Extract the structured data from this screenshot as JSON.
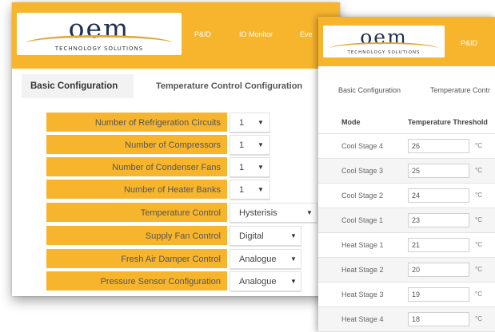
{
  "back_window": {
    "logo": {
      "word": "oem",
      "tagline": "TECHNOLOGY SOLUTIONS"
    },
    "nav": [
      "P&ID",
      "IO Monitor",
      "Eve"
    ],
    "tabs": [
      {
        "label": "Basic Configuration",
        "active": true
      },
      {
        "label": "Temperature Control Configuration",
        "active": false
      }
    ],
    "form": [
      {
        "label": "Number of Refrigeration Circuits",
        "value": "1"
      },
      {
        "label": "Number of Compressors",
        "value": "1"
      },
      {
        "label": "Number of Condenser Fans",
        "value": "1"
      },
      {
        "label": "Number of Heater Banks",
        "value": "1"
      },
      {
        "label": "Temperature Control",
        "value": "Hysterisis"
      },
      {
        "label": "Supply Fan Control",
        "value": "Digital"
      },
      {
        "label": "Fresh Air Damper Control",
        "value": "Analogue"
      },
      {
        "label": "Pressure Sensor Configuration",
        "value": "Analogue"
      }
    ],
    "caret": "▼"
  },
  "front_window": {
    "logo": {
      "word": "oem",
      "tagline": "TECHNOLOGY SOLUTIONS"
    },
    "nav": [
      "P&ID"
    ],
    "tabs": [
      {
        "label": "Basic Configuration",
        "active": false
      },
      {
        "label": "Temperature Contr",
        "active": true
      }
    ],
    "table": {
      "headers": [
        "Mode",
        "Temperature Threshold"
      ],
      "unit": "°C",
      "rows": [
        {
          "mode": "Cool Stage 4",
          "threshold": "26"
        },
        {
          "mode": "Cool Stage 3",
          "threshold": "25"
        },
        {
          "mode": "Cool Stage 2",
          "threshold": "24"
        },
        {
          "mode": "Cool Stage 1",
          "threshold": "23"
        },
        {
          "mode": "Heat Stage 1",
          "threshold": "21"
        },
        {
          "mode": "Heat Stage 2",
          "threshold": "20"
        },
        {
          "mode": "Heat Stage 3",
          "threshold": "19"
        },
        {
          "mode": "Heat Stage 4",
          "threshold": "18"
        }
      ]
    }
  },
  "colors": {
    "accent": "#f7b52e",
    "logo_text": "#1f3050",
    "logo_arc": "#e2a83a"
  }
}
